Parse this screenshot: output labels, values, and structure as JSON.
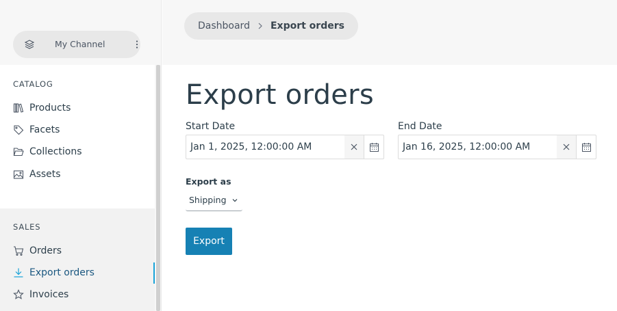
{
  "sidebar": {
    "channel": {
      "label": "My Channel"
    },
    "sections": [
      {
        "title": "CATALOG",
        "items": [
          {
            "label": "Products",
            "icon": "library-icon"
          },
          {
            "label": "Facets",
            "icon": "tag-icon"
          },
          {
            "label": "Collections",
            "icon": "folder-open-icon"
          },
          {
            "label": "Assets",
            "icon": "image-icon"
          }
        ]
      },
      {
        "title": "SALES",
        "items": [
          {
            "label": "Orders",
            "icon": "cart-icon"
          },
          {
            "label": "Export orders",
            "icon": "download-icon",
            "active": true
          },
          {
            "label": "Invoices",
            "icon": "star-icon"
          }
        ]
      }
    ]
  },
  "breadcrumb": {
    "items": [
      "Dashboard",
      "Export orders"
    ]
  },
  "main": {
    "title": "Export orders",
    "start_date": {
      "label": "Start Date",
      "value": "Jan 1, 2025, 12:00:00 AM"
    },
    "end_date": {
      "label": "End Date",
      "value": "Jan 16, 2025, 12:00:00 AM"
    },
    "export_as": {
      "label": "Export as",
      "selected": "Shipping"
    },
    "export_button": {
      "label": "Export"
    }
  },
  "colors": {
    "accent": "#1681b4",
    "active_indicator": "#17a2d8",
    "active_text": "#1a5780"
  }
}
